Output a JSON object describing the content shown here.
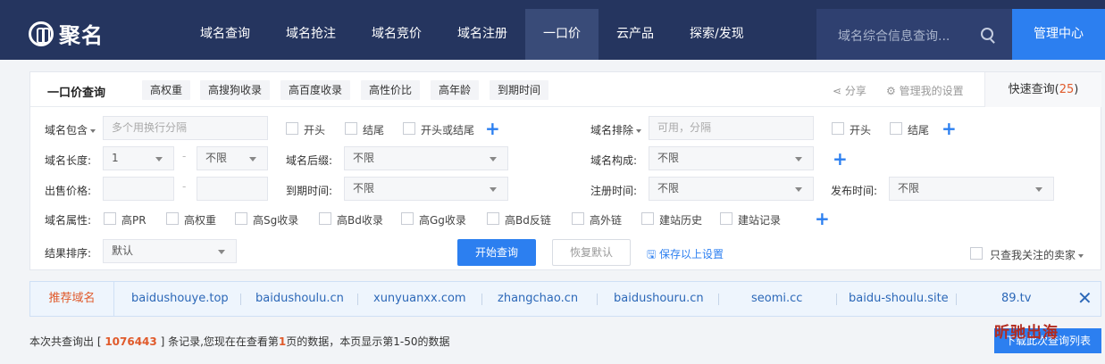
{
  "nav": {
    "logo": "聚名",
    "menu": [
      "域名查询",
      "域名抢注",
      "域名竞价",
      "域名注册",
      "一口价",
      "云产品",
      "探索/发现"
    ],
    "search_placeholder": "域名综合信息查询...",
    "admin": "管理中心"
  },
  "tabs": {
    "title": "一口价查询",
    "chips": [
      "高权重",
      "高搜狗收录",
      "高百度收录",
      "高性价比",
      "高年龄",
      "到期时间"
    ],
    "share": "分享",
    "settings": "管理我的设置",
    "quick": "快速查询(",
    "quick_count": "25",
    "quick_close": ")"
  },
  "filters": {
    "contains_label": "域名包含",
    "contains_placeholder": "多个用换行分隔",
    "cb_start": "开头",
    "cb_end": "结尾",
    "cb_start_or_end": "开头或结尾",
    "exclude_label": "域名排除",
    "exclude_placeholder": "可用，分隔",
    "ex_cb_start": "开头",
    "ex_cb_end": "结尾",
    "length_label": "域名长度:",
    "length_min": "1",
    "dash": "-",
    "length_max": "不限",
    "suffix_label": "域名后缀:",
    "suffix_value": "不限",
    "compose_label": "域名构成:",
    "compose_value": "不限",
    "price_label": "出售价格:",
    "expire_label": "到期时间:",
    "expire_value": "不限",
    "reg_label": "注册时间:",
    "reg_value": "不限",
    "pub_label": "发布时间:",
    "pub_value": "不限",
    "attr_label": "域名属性:",
    "attrs": [
      "高PR",
      "高权重",
      "高Sg收录",
      "高Bd收录",
      "高Gg收录",
      "高Bd反链",
      "高外链",
      "建站历史",
      "建站记录"
    ],
    "sort_label": "结果排序:",
    "sort_value": "默认",
    "search_btn": "开始查询",
    "reset_btn": "恢复默认",
    "save_link": "保存以上设置",
    "only_followed": "只查我关注的卖家"
  },
  "recommend": {
    "label": "推荐域名",
    "items": [
      "baidushouye.top",
      "baidushoulu.cn",
      "xunyuanxx.com",
      "zhangchao.cn",
      "baidushouru.cn",
      "seomi.cc",
      "baidu-shoulu.site",
      "89.tv"
    ]
  },
  "summary": {
    "p1": "本次共查询出 [ ",
    "count": "1076443",
    "p2": " ] 条记录,您现在在查看第",
    "page": "1",
    "p3": "页的数据，本页显示第1-50的数据"
  },
  "download": "下载此次查询列表",
  "watermark": "昕驰出海"
}
